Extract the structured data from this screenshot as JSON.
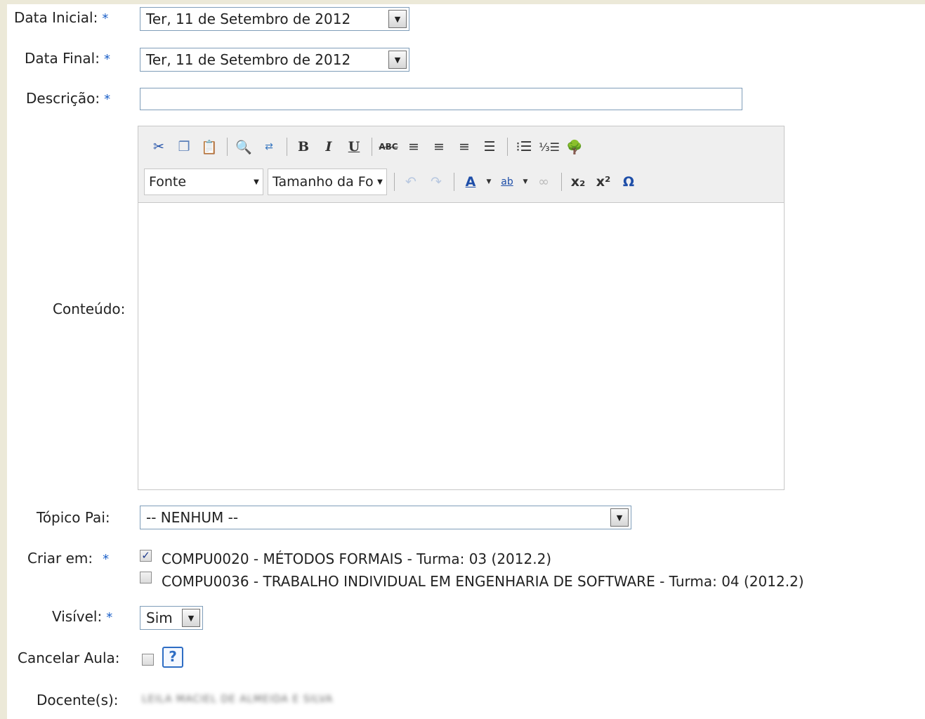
{
  "form": {
    "data_inicial": {
      "label": "Data Inicial:",
      "value": "Ter, 11 de Setembro de 2012"
    },
    "data_final": {
      "label": "Data Final:",
      "value": "Ter, 11 de Setembro de 2012"
    },
    "descricao": {
      "label": "Descrição:",
      "value": ""
    },
    "conteudo": {
      "label": "Conteúdo:"
    },
    "topico_pai": {
      "label": "Tópico Pai:",
      "value": "-- NENHUM --"
    },
    "criar_em": {
      "label": "Criar em:",
      "options": [
        {
          "label": "COMPU0020 - MÉTODOS FORMAIS - Turma: 03 (2012.2)",
          "checked": true
        },
        {
          "label": "COMPU0036 - TRABALHO INDIVIDUAL EM ENGENHARIA DE SOFTWARE - Turma: 04 (2012.2)",
          "checked": false
        }
      ]
    },
    "visivel": {
      "label": "Visível:",
      "value": "Sim"
    },
    "cancelar_aula": {
      "label": "Cancelar Aula:",
      "checked": false,
      "help": "?"
    },
    "docentes": {
      "label": "Docente(s):",
      "value": "LEILA MACIEL DE ALMEIDA E SILVA"
    }
  },
  "editor": {
    "font_select": "Fonte",
    "size_select": "Tamanho da Fo",
    "icons_row1": [
      "cut-icon",
      "copy-icon",
      "paste-icon",
      "find-icon",
      "replace-icon",
      "bold-icon",
      "italic-icon",
      "underline-icon",
      "strikethrough-icon",
      "align-left-icon",
      "align-center-icon",
      "align-right-icon",
      "justify-icon",
      "bullet-list-icon",
      "numbered-list-icon",
      "image-icon"
    ],
    "icons_row2": [
      "undo-icon",
      "redo-icon",
      "text-color-icon",
      "highlight-icon",
      "link-icon",
      "subscript-icon",
      "superscript-icon",
      "special-char-icon"
    ]
  },
  "required_marker": "*",
  "colors": {
    "required_star": "#1a5fc8",
    "page_bg": "#ece9d8"
  }
}
